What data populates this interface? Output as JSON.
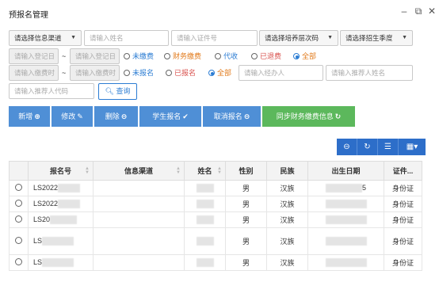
{
  "window": {
    "title": "预报名管理",
    "min": "–",
    "max": "⧉",
    "close": "✕"
  },
  "filters": {
    "channel_select": "请选择信息渠道",
    "name_placeholder": "请输入姓名",
    "idcard_placeholder": "请输入证件号",
    "level_select": "请选择培养层次码",
    "season_select": "请选择招生季度",
    "reg_from": "请输入登记日",
    "reg_to": "请输入登记日",
    "pay_from": "请输入缴费时",
    "pay_to": "请输入缴费时",
    "tilde": "~",
    "pay_status": [
      "未缴费",
      "财务缴费",
      "代收",
      "已退费",
      "全部"
    ],
    "reg_status": [
      "未报名",
      "已报名",
      "全部"
    ],
    "handler_placeholder": "请输入经办人",
    "referrer_name_placeholder": "请输入推荐人姓名",
    "referrer_code_placeholder": "请输入推荐人代码",
    "query_label": "查询"
  },
  "toolbar": {
    "add": "新增",
    "edit": "修改",
    "delete": "删除",
    "enroll": "学生报名",
    "cancel": "取消报名",
    "sync": "同步财务缴费信息"
  },
  "grid_tools": {
    "collapse": "⊖",
    "refresh": "↻",
    "list": "☰",
    "columns": "▦▾"
  },
  "table": {
    "headers": [
      "",
      "报名号",
      "信息渠道",
      "姓名",
      "性别",
      "民族",
      "出生日期",
      "证件..."
    ],
    "rows": [
      {
        "id": "LS2022",
        "gender": "男",
        "ethnic": "汉族",
        "birth_tail": "5",
        "idtype": "身份证"
      },
      {
        "id": "LS2022",
        "gender": "男",
        "ethnic": "汉族",
        "birth_tail": "",
        "idtype": "身份证"
      },
      {
        "id": "LS20",
        "gender": "男",
        "ethnic": "汉族",
        "birth_tail": "",
        "idtype": "身份证"
      },
      {
        "id": "LS",
        "gender": "男",
        "ethnic": "汉族",
        "birth_tail": "",
        "idtype": "身份证"
      },
      {
        "id": "LS",
        "gender": "男",
        "ethnic": "汉族",
        "birth_tail": "",
        "idtype": "身份证"
      }
    ]
  },
  "colors": {
    "accent": "#2b7cd3",
    "toolbar_blue": "#4f8fd6",
    "sync_green": "#5cb85c",
    "orange": "#e27b1c",
    "red": "#d9534f"
  }
}
